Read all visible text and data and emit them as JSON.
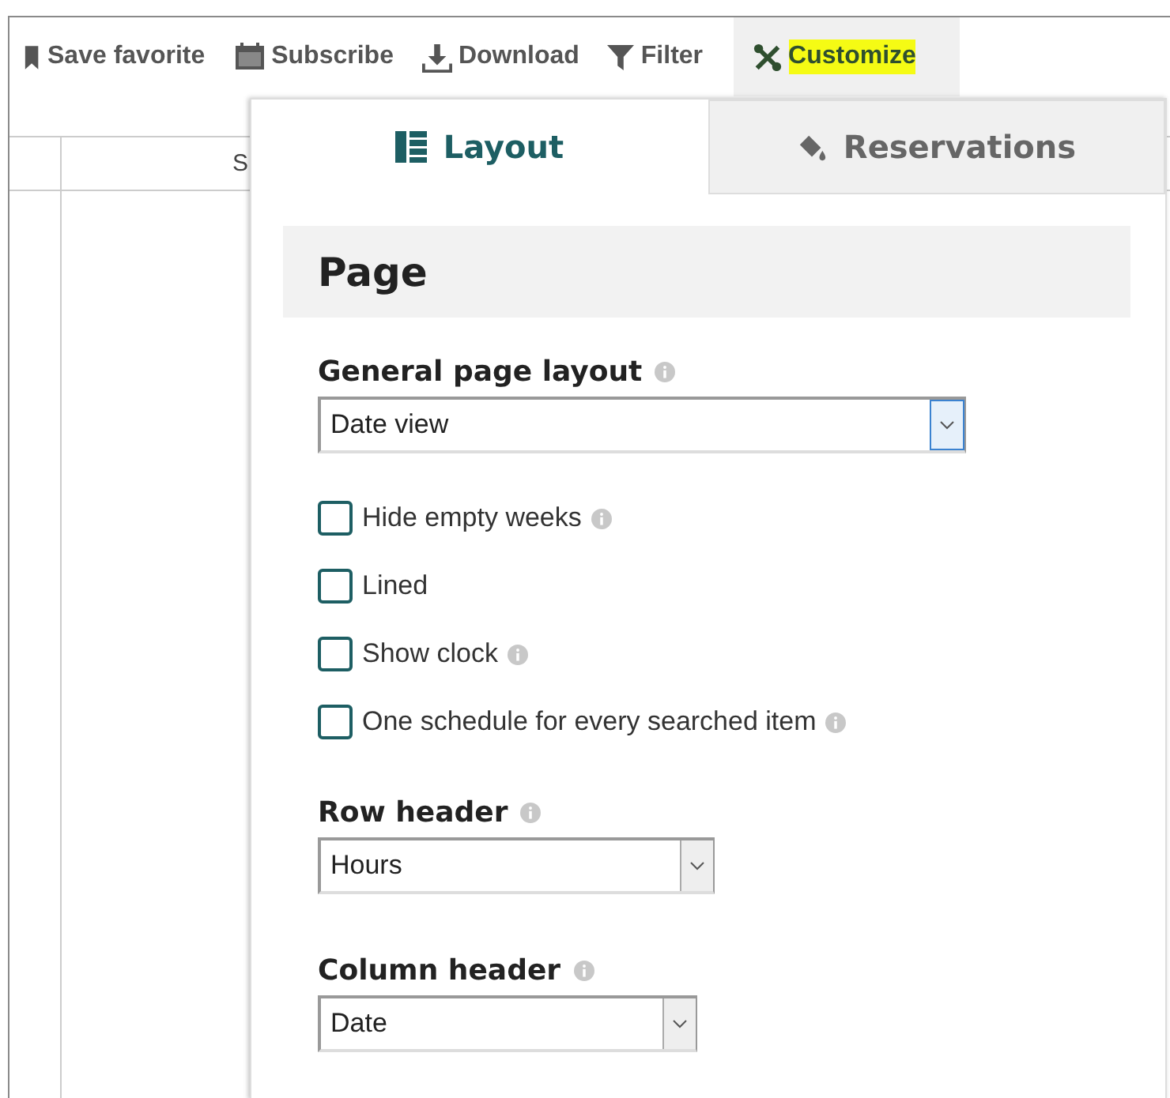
{
  "toolbar": [
    {
      "label": "Save favorite",
      "kind": "bookmark",
      "selected": false,
      "highlighted": false
    },
    {
      "label": "Subscribe",
      "kind": "calendar",
      "selected": false,
      "highlighted": false
    },
    {
      "label": "Download",
      "kind": "download",
      "selected": false,
      "highlighted": false
    },
    {
      "label": "Filter",
      "kind": "filter",
      "selected": false,
      "highlighted": false
    },
    {
      "label": "Customize",
      "kind": "tools",
      "selected": true,
      "highlighted": true
    }
  ],
  "table": {
    "column_2": "S"
  },
  "tabs": [
    {
      "label": "Layout",
      "kind": "layout",
      "selected": true
    },
    {
      "label": "Reservations",
      "kind": "paint",
      "selected": false
    }
  ],
  "section": {
    "title": "Page"
  },
  "general_page_layout": {
    "label": "General page layout",
    "info": true,
    "value": "Date view",
    "focused": true
  },
  "checkboxes": [
    {
      "label": "Hide empty weeks",
      "info": true,
      "checked": false
    },
    {
      "label": "Lined",
      "info": false,
      "checked": false
    },
    {
      "label": "Show clock",
      "info": true,
      "checked": false
    },
    {
      "label": "One schedule for every searched item",
      "info": true,
      "checked": false
    }
  ],
  "row_header": {
    "label": "Row header",
    "info": true,
    "value": "Hours",
    "focused": false
  },
  "column_header": {
    "label": "Column header",
    "info": true,
    "value": "Date",
    "focused": false
  }
}
